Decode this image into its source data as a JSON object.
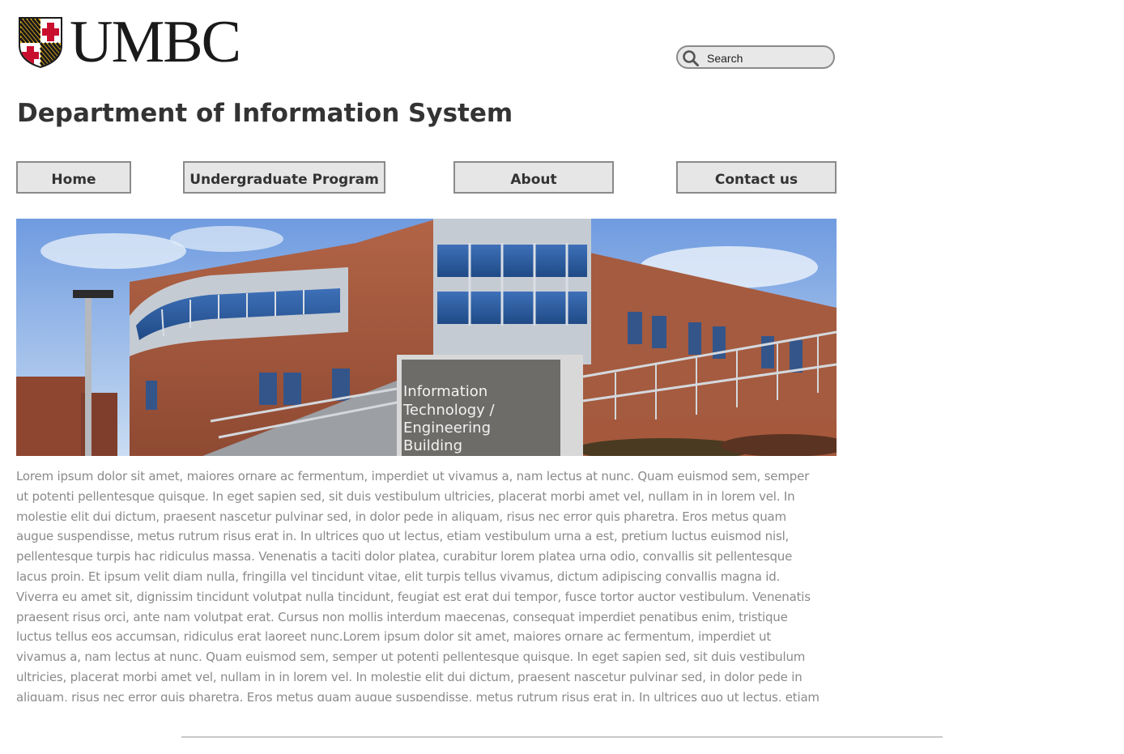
{
  "brand": {
    "logo_text": "UMBC",
    "colors": {
      "gold": "#f2b81c",
      "black": "#1a1a1a",
      "red": "#c8102e",
      "white": "#ffffff"
    }
  },
  "search": {
    "placeholder": "Search",
    "icon": "search-icon"
  },
  "page_title": "Department of Information System",
  "nav": [
    {
      "label": "Home"
    },
    {
      "label": "Undergraduate Program"
    },
    {
      "label": "About"
    },
    {
      "label": "Contact us"
    }
  ],
  "hero": {
    "sign_lines": [
      "Information",
      "Technology /",
      "Engineering",
      "Building"
    ]
  },
  "body_text": "Lorem ipsum dolor sit amet, maiores ornare ac fermentum, imperdiet ut vivamus a, nam lectus at nunc. Quam euismod sem, semper ut potenti pellentesque quisque. In eget sapien sed, sit duis vestibulum ultricies, placerat morbi amet vel, nullam in in lorem vel. In molestie elit dui dictum, praesent nascetur pulvinar sed, in dolor pede in aliquam, risus nec error quis pharetra. Eros metus quam augue suspendisse, metus rutrum risus erat in.  In ultrices quo ut lectus, etiam vestibulum urna a est, pretium luctus euismod nisl, pellentesque turpis hac ridiculus massa. Venenatis a taciti dolor platea, curabitur lorem platea urna odio, convallis sit pellentesque lacus proin. Et ipsum velit diam nulla, fringilla vel tincidunt vitae, elit turpis tellus vivamus, dictum adipiscing convallis magna id. Viverra eu amet sit, dignissim tincidunt volutpat nulla tincidunt, feugiat est erat dui tempor, fusce tortor auctor vestibulum. Venenatis praesent risus orci, ante nam volutpat erat. Cursus non mollis interdum maecenas, consequat imperdiet penatibus enim, tristique luctus tellus eos accumsan, ridiculus erat laoreet nunc.Lorem ipsum dolor sit amet, maiores ornare ac fermentum, imperdiet ut vivamus a, nam lectus at nunc. Quam euismod sem, semper ut potenti pellentesque quisque. In eget sapien sed, sit duis vestibulum ultricies, placerat morbi amet vel, nullam in in lorem vel. In molestie elit dui dictum, praesent nascetur pulvinar sed, in dolor pede in aliquam, risus nec error quis pharetra. Eros metus quam augue suspendisse, metus rutrum risus erat in.  In ultrices quo ut lectus, etiam vestibulum urna a est, pretium"
}
